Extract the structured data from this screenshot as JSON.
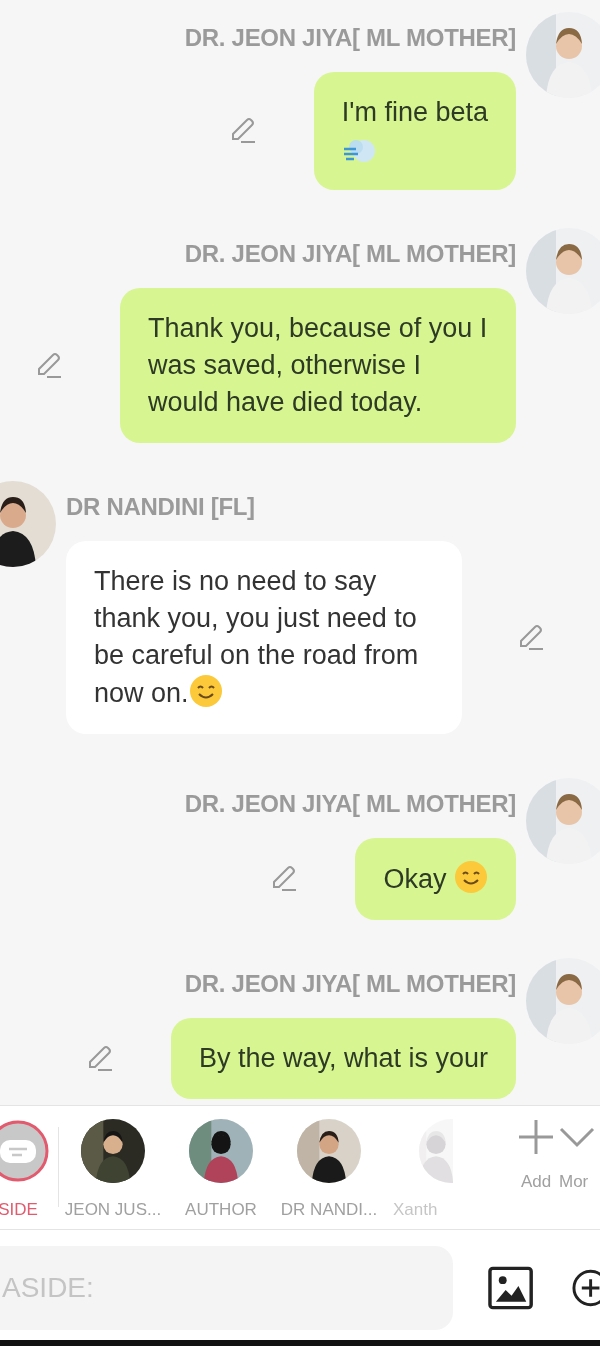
{
  "messages": [
    {
      "outgoing": true,
      "sender": "DR. JEON JIYA[ ML MOTHER]",
      "text": "I'm fine beta",
      "sticker": {
        "kind": "wind"
      }
    },
    {
      "outgoing": true,
      "sender": "DR. JEON JIYA[ ML MOTHER]",
      "text": "Thank you, because of you I was saved, otherwise I would have died today."
    },
    {
      "outgoing": false,
      "sender": "DR NANDINI [FL]",
      "text": "There is no need to say thank you, you just need to be careful on the road from now on.",
      "sticker": {
        "kind": "smile"
      }
    },
    {
      "outgoing": true,
      "sender": "DR. JEON JIYA[ ML MOTHER]",
      "text": "Okay ",
      "sticker": {
        "kind": "smile"
      }
    },
    {
      "outgoing": true,
      "sender": "DR. JEON JIYA[ ML MOTHER]",
      "text": "By the way, what is your"
    }
  ],
  "cast": [
    {
      "kind": "aside",
      "label": "SIDE",
      "selected": true
    },
    {
      "kind": "character",
      "label": "JEON JUS...",
      "selected": false
    },
    {
      "kind": "character",
      "label": "AUTHOR",
      "selected": false
    },
    {
      "kind": "character",
      "label": "DR NANDI...",
      "selected": false
    },
    {
      "kind": "character",
      "label": "Xanth",
      "selected": false
    }
  ],
  "cast_actions": [
    {
      "kind": "add",
      "label": "Add"
    },
    {
      "kind": "more",
      "label": "Mor"
    }
  ],
  "composer": {
    "placeholder": "ASIDE:"
  }
}
